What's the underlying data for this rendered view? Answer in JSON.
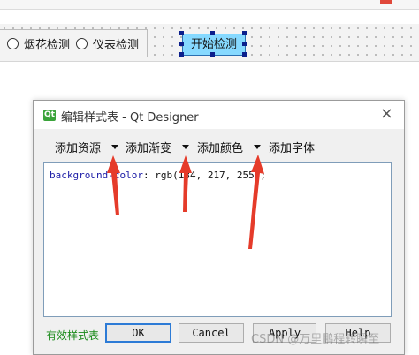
{
  "form": {
    "radio_fireworks": "烟花检测",
    "radio_meter": "仪表检测",
    "start_button": "开始检测"
  },
  "dialog": {
    "title": "编辑样式表 - Qt Designer",
    "close_glyph": "×",
    "icon_label": "Qt",
    "toolbar": {
      "add_resource": "添加资源",
      "add_gradient": "添加渐变",
      "add_color": "添加颜色",
      "add_font": "添加字体"
    },
    "code": {
      "property": "background-color",
      "value": ": rgb(134, 217, 255);"
    },
    "status": "有效样式表",
    "buttons": {
      "ok": "OK",
      "cancel": "Cancel",
      "apply": "Apply",
      "help": "Help"
    }
  },
  "watermark": "CSDN @万里鹏程转瞬至",
  "colors": {
    "start_button_bg": "#86d9ff",
    "annotation_arrow": "#e53b2a",
    "valid_text": "#1a8a1a"
  }
}
